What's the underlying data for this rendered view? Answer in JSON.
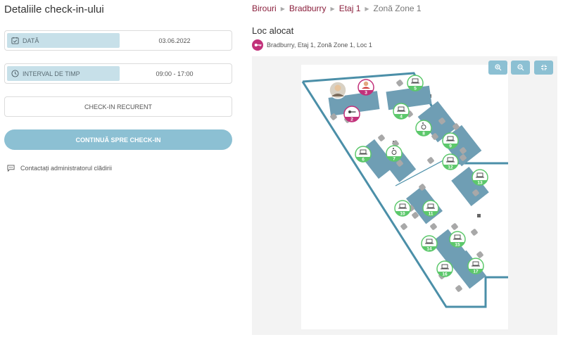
{
  "left": {
    "title": "Detaliile check-in-ului",
    "date": {
      "label": "DATĂ",
      "value": "03.06.2022",
      "icon": "calendar-check-icon"
    },
    "interval": {
      "label": "INTERVAL DE TIMP",
      "value": "09:00 - 17:00",
      "icon": "clock-icon"
    },
    "recurent_label": "CHECK-IN RECURENT",
    "continue_label": "CONTINUĂ SPRE CHECK-IN",
    "contact_label": "Contactați administratorul clădirii"
  },
  "breadcrumb": [
    "Birouri",
    "Bradburry",
    "Etaj 1",
    "Zonă Zone 1"
  ],
  "allocated": {
    "title": "Loc alocat",
    "seat_text": "Bradburry, Etaj 1, Zonă Zone 1, Loc 1"
  },
  "map": {
    "seats": [
      {
        "n": "2",
        "type": "key",
        "color": "#c2317a"
      },
      {
        "n": "3",
        "type": "avatar",
        "color": "#c2317a"
      },
      {
        "n": "4",
        "type": "laptop",
        "color": "#5cc86b"
      },
      {
        "n": "5",
        "type": "laptop",
        "color": "#5cc86b"
      },
      {
        "n": "6",
        "type": "laptop",
        "color": "#5cc86b"
      },
      {
        "n": "7",
        "type": "wheelchair",
        "color": "#5cc86b"
      },
      {
        "n": "8",
        "type": "wheelchair",
        "color": "#5cc86b"
      },
      {
        "n": "9",
        "type": "laptop",
        "color": "#5cc86b"
      },
      {
        "n": "10",
        "type": "laptop",
        "color": "#5cc86b"
      },
      {
        "n": "11",
        "type": "laptop",
        "color": "#5cc86b"
      },
      {
        "n": "12",
        "type": "laptop",
        "color": "#5cc86b"
      },
      {
        "n": "13",
        "type": "laptop",
        "color": "#5cc86b"
      },
      {
        "n": "14",
        "type": "laptop",
        "color": "#5cc86b"
      },
      {
        "n": "15",
        "type": "laptop",
        "color": "#5cc86b"
      },
      {
        "n": "16",
        "type": "laptop",
        "color": "#5cc86b"
      },
      {
        "n": "17",
        "type": "laptop",
        "color": "#5cc86b"
      }
    ],
    "controls": [
      "zoom-in-icon",
      "zoom-out-icon",
      "fit-screen-icon"
    ]
  },
  "colors": {
    "accent": "#8cc0d3",
    "brand": "#8a1f3c",
    "occupied": "#c2317a",
    "available": "#5cc86b",
    "wall": "#4b8fa8"
  }
}
